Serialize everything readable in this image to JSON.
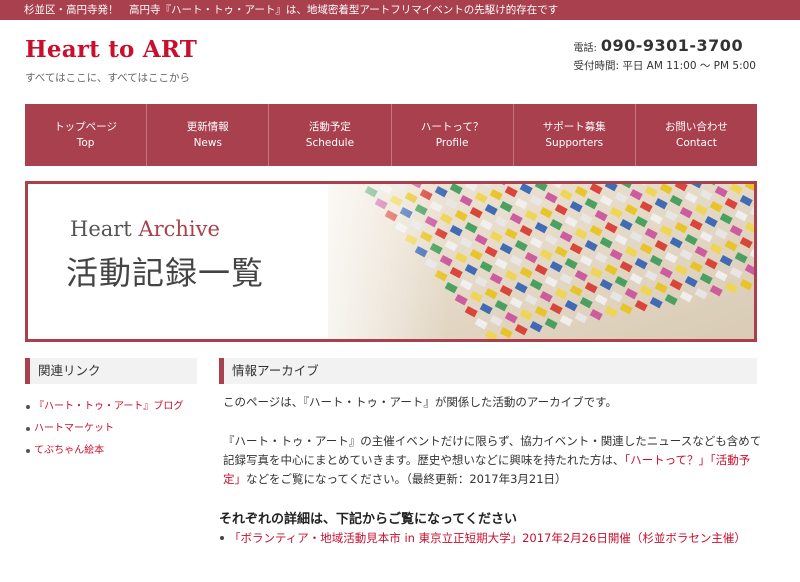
{
  "topbar": {
    "text": "杉並区・高円寺発！　高円寺『ハート・トゥ・アート』は、地域密着型アートフリマイベントの先駆け的存在です"
  },
  "header": {
    "site_title": "Heart to ART",
    "tagline": "すべてはここに、すべてはここから",
    "phone_label": "電話:",
    "phone_number": "090-9301-3700",
    "hours": "受付時間: 平日 AM 11:00 〜 PM 5:00"
  },
  "nav": {
    "items": [
      {
        "ja": "トップページ",
        "en": "Top"
      },
      {
        "ja": "更新情報",
        "en": "News"
      },
      {
        "ja": "活動予定",
        "en": "Schedule"
      },
      {
        "ja": "ハートって？",
        "en": "Profile"
      },
      {
        "ja": "サポート募集",
        "en": "Supporters"
      },
      {
        "ja": "お問い合わせ",
        "en": "Contact"
      }
    ]
  },
  "hero": {
    "en_word1": "Heart",
    "en_word2": "Archive",
    "ja_title": "活動記録一覧"
  },
  "sidebar": {
    "heading": "関連リンク",
    "links": [
      "『ハート・トゥ・アート』ブログ",
      "ハートマーケット",
      "てぶちゃん絵本"
    ]
  },
  "main": {
    "heading": "情報アーカイブ",
    "para1": "このページは、『ハート・トゥ・アート』が関係した活動のアーカイブです。",
    "para2_a": "『ハート・トゥ・アート』の主催イベントだけに限らず、協力イベント・関連したニュースなども含めて記録写真を中心にまとめていきます。歴史や想いなどに興味を持たれた方は、",
    "para2_link1": "「ハートって？」",
    "para2_link2": "「活動予定」",
    "para2_b": "などをご覧になってください。（最終更新：2017年3月21日）",
    "section_heading": "それぞれの詳細は、下記からご覧になってください",
    "archive_items": [
      "「ボランティア・地域活動見本市 in 東京立正短期大学」2017年2月26日開催（杉並ボラセン主催）"
    ]
  },
  "colors": {
    "accent": "#a8404e",
    "link": "#c8102e",
    "title": "#c8102e"
  }
}
